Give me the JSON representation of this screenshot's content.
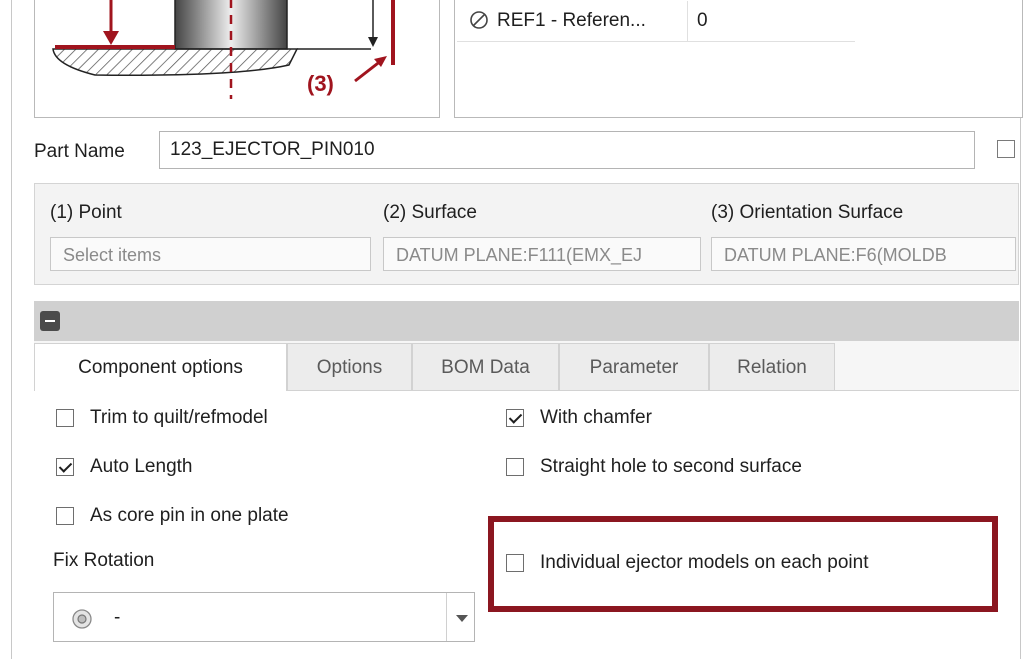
{
  "preview": {
    "callout_label": "(3)"
  },
  "reference_table": {
    "row_name": "REF1 - Referen...",
    "row_value": "0"
  },
  "part_name": {
    "label": "Part Name",
    "value": "123_EJECTOR_PIN010"
  },
  "ref_group": {
    "point": {
      "label": "(1) Point",
      "placeholder": "Select items"
    },
    "surface": {
      "label": "(2) Surface",
      "value": "DATUM PLANE:F111(EMX_EJ"
    },
    "orientation": {
      "label": "(3) Orientation Surface",
      "value": "DATUM PLANE:F6(MOLDB"
    }
  },
  "tabs": [
    {
      "label": "Component options",
      "active": true
    },
    {
      "label": "Options"
    },
    {
      "label": "BOM Data"
    },
    {
      "label": "Parameter"
    },
    {
      "label": "Relation"
    }
  ],
  "options": {
    "trim": {
      "label": "Trim to quilt/refmodel",
      "checked": false
    },
    "auto_length": {
      "label": "Auto Length",
      "checked": true
    },
    "core_pin": {
      "label": "As core pin in one plate",
      "checked": false
    },
    "with_chamfer": {
      "label": "With chamfer",
      "checked": true
    },
    "straight_hole": {
      "label": "Straight hole to second surface",
      "checked": false
    },
    "individual": {
      "label": "Individual ejector models on each point",
      "checked": false
    }
  },
  "fix_rotation": {
    "label": "Fix Rotation",
    "value": "-"
  },
  "colors": {
    "highlight": "#8b1620",
    "section_bar": "#d0d0d0",
    "accent_red": "#a0141e"
  }
}
